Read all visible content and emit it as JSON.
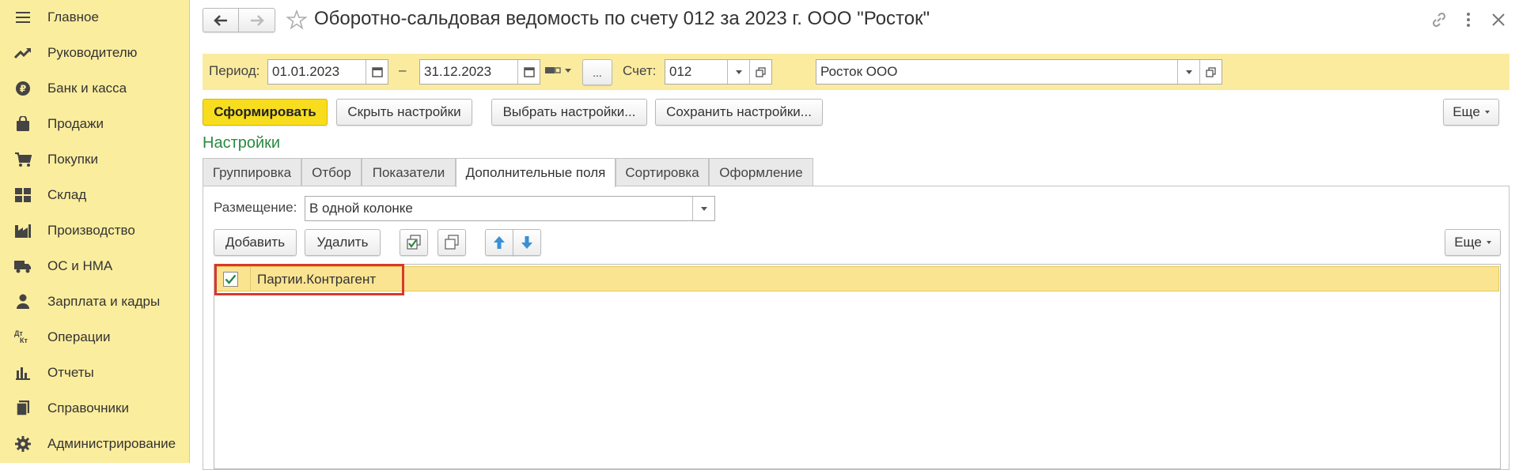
{
  "sidebar": {
    "items": [
      {
        "label": "Главное",
        "icon": "menu-icon"
      },
      {
        "label": "Руководителю",
        "icon": "trend-icon"
      },
      {
        "label": "Банк и касса",
        "icon": "ruble-icon"
      },
      {
        "label": "Продажи",
        "icon": "bag-icon"
      },
      {
        "label": "Покупки",
        "icon": "cart-icon"
      },
      {
        "label": "Склад",
        "icon": "warehouse-icon"
      },
      {
        "label": "Производство",
        "icon": "factory-icon"
      },
      {
        "label": "ОС и НМА",
        "icon": "truck-icon"
      },
      {
        "label": "Зарплата и кадры",
        "icon": "person-icon"
      },
      {
        "label": "Операции",
        "icon": "dt-kt-icon",
        "icon_text": "Дт\nКт"
      },
      {
        "label": "Отчеты",
        "icon": "bar-chart-icon"
      },
      {
        "label": "Справочники",
        "icon": "book-icon"
      },
      {
        "label": "Администрирование",
        "icon": "gear-icon"
      }
    ]
  },
  "header": {
    "title": "Оборотно-сальдовая ведомость по счету 012 за 2023 г. ООО \"Росток\""
  },
  "params": {
    "period_label": "Период:",
    "date_from": "01.01.2023",
    "dash": "–",
    "date_to": "31.12.2023",
    "ellipsis": "...",
    "account_label": "Счет:",
    "account": "012",
    "org": "Росток ООО"
  },
  "toolbar": {
    "generate": "Сформировать",
    "hide_settings": "Скрыть настройки",
    "choose_settings": "Выбрать настройки...",
    "save_settings": "Сохранить настройки...",
    "more": "Еще"
  },
  "settings": {
    "title": "Настройки",
    "tabs": [
      "Группировка",
      "Отбор",
      "Показатели",
      "Дополнительные поля",
      "Сортировка",
      "Оформление"
    ],
    "active_tab": "Дополнительные поля",
    "placement_label": "Размещение:",
    "placement_value": "В одной колонке",
    "add": "Добавить",
    "delete": "Удалить",
    "more": "Еще",
    "rows": [
      {
        "checked": true,
        "field": "Партии.Контрагент"
      }
    ]
  },
  "colors": {
    "sidebar_bg": "#fbed9e",
    "params_bg": "#fbeb9f",
    "primary_button": "#f7dd1e",
    "accent_green": "#2a8a3e",
    "selected_row": "#fbe491",
    "highlight_box": "#d9382c"
  }
}
